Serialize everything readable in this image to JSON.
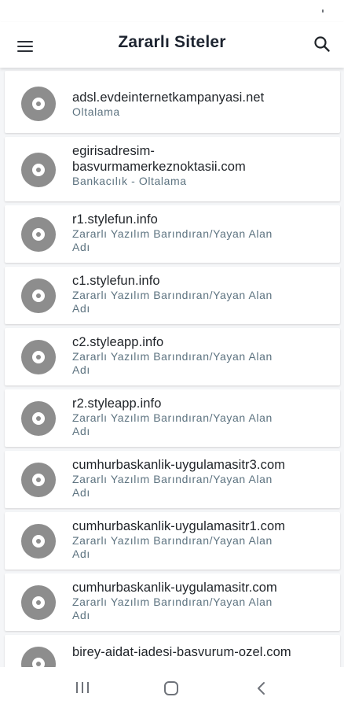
{
  "app_bar": {
    "title": "Zararlı Siteler",
    "menu_icon": "hamburger-menu-icon",
    "search_icon": "search-icon"
  },
  "sites": [
    {
      "domain": "adsl.evdeinternetkampanyasi.net",
      "category": "Oltalama"
    },
    {
      "domain": "egirisadresim-basvurmamerkeznoktasii.com",
      "domain_line1": "egirisadresim-",
      "domain_line2": "basvurmamerkeznoktasii.com",
      "category": "Bankacılık - Oltalama"
    },
    {
      "domain": "r1.stylefun.info",
      "category_line1": "Zararlı Yazılım Barındıran/Yayan Alan",
      "category_line2": "Adı"
    },
    {
      "domain": "c1.stylefun.info",
      "category_line1": "Zararlı Yazılım Barındıran/Yayan Alan",
      "category_line2": "Adı"
    },
    {
      "domain": "c2.styleapp.info",
      "category_line1": "Zararlı Yazılım Barındıran/Yayan Alan",
      "category_line2": "Adı"
    },
    {
      "domain": "r2.styleapp.info",
      "category_line1": "Zararlı Yazılım Barındıran/Yayan Alan",
      "category_line2": "Adı"
    },
    {
      "domain": "cumhurbaskanlik-uygulamasitr3.com",
      "category_line1": "Zararlı Yazılım Barındıran/Yayan Alan",
      "category_line2": "Adı"
    },
    {
      "domain": "cumhurbaskanlik-uygulamasitr1.com",
      "category_line1": "Zararlı Yazılım Barındıran/Yayan Alan",
      "category_line2": "Adı"
    },
    {
      "domain": "cumhurbaskanlik-uygulamasitr.com",
      "category_line1": "Zararlı Yazılım Barındıran/Yayan Alan",
      "category_line2": "Adı"
    },
    {
      "domain": "birey-aidat-iadesi-basvurum-ozel.com"
    }
  ],
  "nav_bar": {
    "recents_icon": "recent-apps-icon",
    "home_icon": "home-circle-icon",
    "back_icon": "back-chevron-icon"
  },
  "colors": {
    "disc_icon": "#8d8d8d",
    "category_text": "#5d7380",
    "background": "#f5f6f8"
  }
}
